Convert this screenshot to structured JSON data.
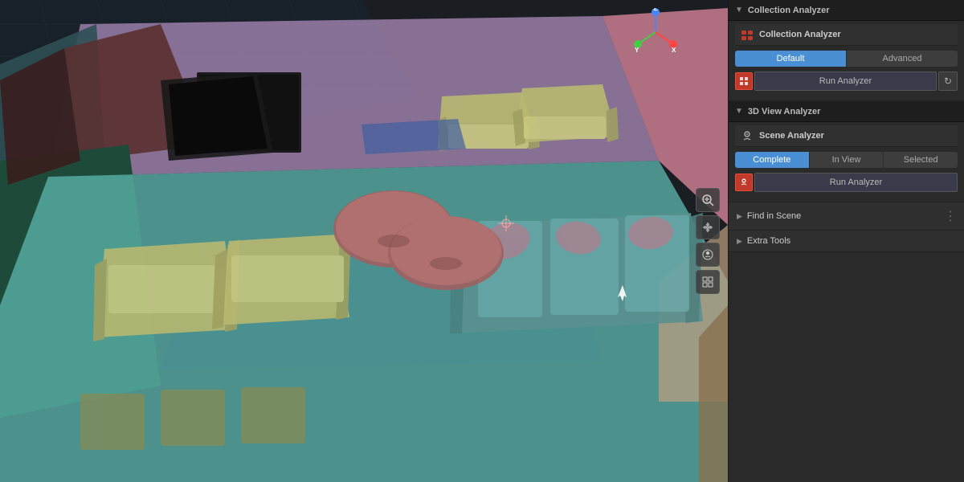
{
  "viewport": {
    "background_color": "#1e2a2e"
  },
  "panel": {
    "title": "Collection Analyzer",
    "sections": {
      "collection_analyzer": {
        "label": "Collection Analyzer",
        "sub_label": "Collection Analyzer",
        "tabs": [
          {
            "id": "default",
            "label": "Default",
            "active": true
          },
          {
            "id": "advanced",
            "label": "Advanced",
            "active": false
          }
        ],
        "run_analyzer_label": "Run Analyzer",
        "refresh_icon": "↻"
      },
      "view_analyzer": {
        "label": "3D View Analyzer",
        "scene_analyzer_label": "Scene Analyzer",
        "tabs": [
          {
            "id": "complete",
            "label": "Complete",
            "active": true
          },
          {
            "id": "in_view",
            "label": "In View",
            "active": false
          },
          {
            "id": "selected",
            "label": "Selected",
            "active": false
          }
        ],
        "run_analyzer_label": "Run Analyzer"
      },
      "find_in_scene": {
        "label": "Find in Scene"
      },
      "extra_tools": {
        "label": "Extra Tools"
      }
    }
  },
  "tools": {
    "magnify_icon": "🔍",
    "hand_icon": "✋",
    "camera_icon": "🎥",
    "grid_icon": "⊞"
  },
  "axis": {
    "x_label": "X",
    "y_label": "Y",
    "z_label": "Z"
  }
}
